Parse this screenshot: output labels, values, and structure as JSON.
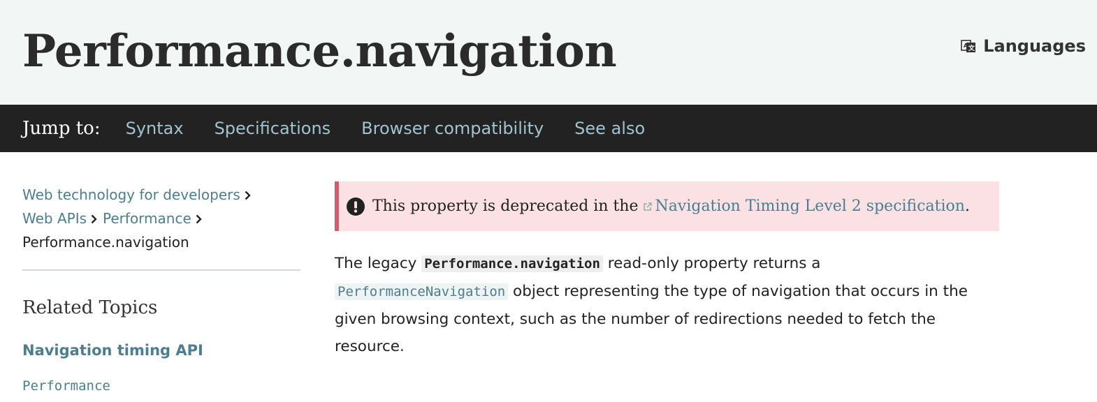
{
  "header": {
    "title": "Performance.navigation",
    "languages_label": "Languages"
  },
  "jump_nav": {
    "label": "Jump to:",
    "links": [
      "Syntax",
      "Specifications",
      "Browser compatibility",
      "See also"
    ]
  },
  "sidebar": {
    "breadcrumbs": [
      "Web technology for developers",
      "Web APIs",
      "Performance"
    ],
    "current": "Performance.navigation",
    "related_heading": "Related Topics",
    "section_title": "Navigation timing API",
    "items": [
      "Performance"
    ]
  },
  "notice": {
    "text_before": "This property is deprecated in the",
    "link_text": "Navigation Timing Level 2 specification",
    "text_after": "."
  },
  "body": {
    "p1_text1": "The legacy ",
    "code_property": "Performance.navigation",
    "p1_text2": " read-only property returns a",
    "code_link": "PerformanceNavigation",
    "p1_text3": " object representing the type of navigation that occurs in the given browsing context, such as the number of redirections needed to fetch the resource."
  },
  "colors": {
    "link": "#4b7e8e",
    "nav_background": "#222222",
    "header_background": "#f2f6f5",
    "notice_background": "#fbe1e4",
    "notice_border": "#d15a6c"
  },
  "icons": [
    "languages-icon",
    "chevron-right-icon",
    "exclamation-circle-icon",
    "external-link-icon"
  ]
}
